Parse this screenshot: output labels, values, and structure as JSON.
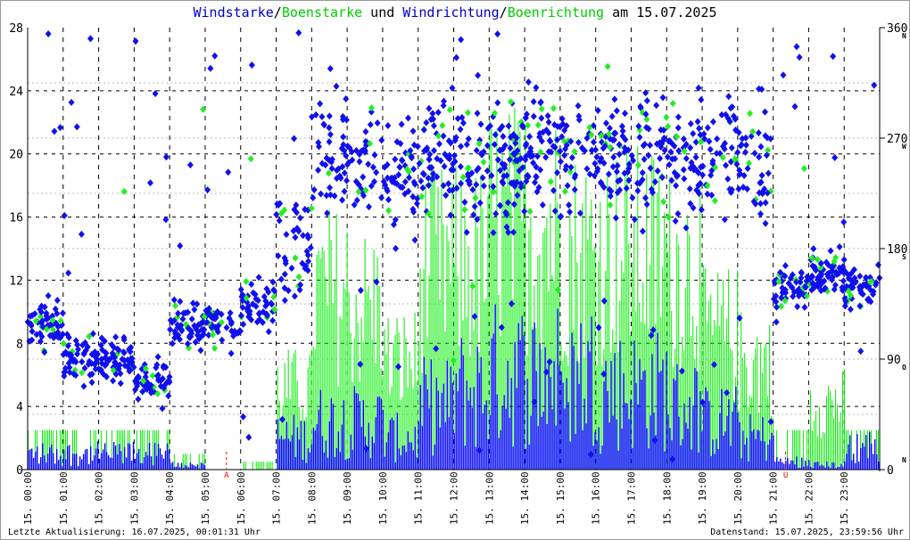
{
  "title": {
    "p1": "Windstarke",
    "s1": "/",
    "p2": "Boenstarke",
    "p3": " und ",
    "p4": "Windrichtung",
    "s2": "/",
    "p5": "Boenrichtung",
    "p6": " am 15.07.2025"
  },
  "footer": {
    "left": "Letzte Aktualisierung: 16.07.2025, 00:01:31 Uhr",
    "right": "Datenstand: 15.07.2025, 23:59:56 Uhr"
  },
  "colors": {
    "wind": "#0000ff",
    "gust": "#00ee00",
    "marker": "#ff0000"
  },
  "chart_data": {
    "type": "bar+scatter",
    "title": "Windstarke/Boenstarke und Windrichtung/Boenrichtung am 15.07.2025",
    "x_ticks": [
      "15. 00:00",
      "15. 01:00",
      "15. 02:00",
      "15. 03:00",
      "15. 04:00",
      "15. 05:00",
      "15. 06:00",
      "15. 07:00",
      "15. 08:00",
      "15. 09:00",
      "15. 10:00",
      "15. 11:00",
      "15. 12:00",
      "15. 13:00",
      "15. 14:00",
      "15. 15:00",
      "15. 16:00",
      "15. 17:00",
      "15. 18:00",
      "15. 19:00",
      "15. 20:00",
      "15. 21:00",
      "15. 22:00",
      "15. 23:00"
    ],
    "ylim": [
      0,
      28
    ],
    "y_ticks": [
      "0",
      "4",
      "8",
      "12",
      "16",
      "20",
      "24",
      "28"
    ],
    "y2lim": [
      0,
      360
    ],
    "y2_ticks": [
      {
        "v": "0",
        "d": "N"
      },
      {
        "v": "90",
        "d": "O"
      },
      {
        "v": "180",
        "d": "S"
      },
      {
        "v": "270",
        "d": "W"
      },
      {
        "v": "360",
        "d": "N"
      }
    ],
    "hours": [
      0,
      1,
      2,
      3,
      4,
      5,
      6,
      7,
      8,
      9,
      10,
      11,
      12,
      13,
      14,
      15,
      16,
      17,
      18,
      19,
      20,
      21,
      22,
      23
    ],
    "series": [
      {
        "name": "Windstarke",
        "values": [
          1,
          1,
          1,
          1,
          0.3,
          0,
          0,
          2,
          3,
          3,
          2,
          4,
          5,
          6,
          6,
          6,
          5,
          5,
          4,
          3,
          2,
          0.5,
          0.3,
          1.5
        ]
      },
      {
        "name": "Boenstarke",
        "values": [
          2.5,
          2.5,
          2.5,
          2.5,
          1,
          0,
          0.5,
          6,
          13,
          12,
          8,
          15,
          15,
          18,
          18,
          16,
          16,
          16,
          15,
          10,
          8,
          2.5,
          5,
          2.5
        ]
      },
      {
        "name": "Windrichtung",
        "values": [
          120,
          90,
          90,
          70,
          115,
          120,
          135,
          180,
          255,
          250,
          240,
          255,
          250,
          250,
          260,
          260,
          255,
          255,
          250,
          260,
          255,
          150,
          160,
          150
        ]
      }
    ],
    "annotations": [
      {
        "hour": 5.6,
        "label": "A"
      },
      {
        "hour": 21.35,
        "label": "U"
      }
    ]
  }
}
